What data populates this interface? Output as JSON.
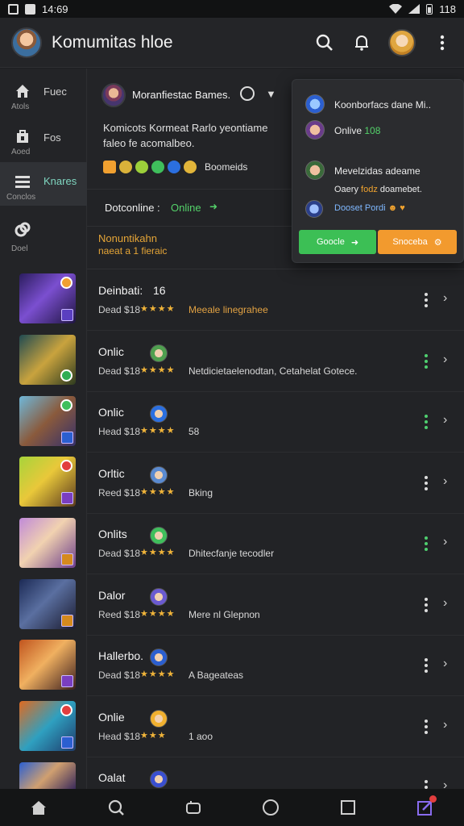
{
  "status_bar": {
    "time": "14:69",
    "battery": "118"
  },
  "app_bar": {
    "title": "Komumitas hloe"
  },
  "sidebar": {
    "items": [
      {
        "label": "Fuec",
        "sub": "Atols",
        "icon": "home-icon"
      },
      {
        "label": "Fos",
        "sub": "Aoed",
        "icon": "store-icon"
      },
      {
        "label": "Knares",
        "sub": "Conclos",
        "icon": "list-icon"
      },
      {
        "label": "",
        "sub": "Doel",
        "icon": "link-icon"
      }
    ]
  },
  "header_card": {
    "name": "Moranfiestac Bames.",
    "description": "Komicots Kormeat Rarlo yeontiame faleo fe acomalbeo.",
    "badge_label": "Boomeids"
  },
  "online_row": {
    "label": "Dotconline :",
    "value": "Online"
  },
  "notice": {
    "line1": "Nonuntikahn",
    "line2": "naeat a 1 fieraic"
  },
  "games": [
    {
      "title": "Deinbati:",
      "count": "16",
      "sub": "Dead $18",
      "stars": "★★★★",
      "tag": "Meeale linegrahee",
      "tag_style": "orange",
      "dots": "white"
    },
    {
      "title": "Onlic",
      "sub": "Dead $18",
      "stars": "★★★★",
      "tag": "Netdicietaelenodtan, Cetahelat Gotece.",
      "tag_style": "white",
      "dots": "green"
    },
    {
      "title": "Onlic",
      "sub": "Head $18",
      "stars": "★★★★",
      "tag": "58",
      "tag_style": "white",
      "dots": "green"
    },
    {
      "title": "Orltic",
      "sub": "Reed $18",
      "stars": "★★★★",
      "tag": "Bking",
      "tag_style": "white",
      "dots": "white"
    },
    {
      "title": "Onlits",
      "sub": "Dead $18",
      "stars": "★★★★",
      "tag": "Dhitecfanje tecodler",
      "tag_style": "white",
      "dots": "green"
    },
    {
      "title": "Dalor",
      "sub": "Reed $18",
      "stars": "★★★★",
      "tag": "Mere nl Glepnon",
      "tag_style": "white",
      "dots": "white"
    },
    {
      "title": "Hallerbo.",
      "sub": "Dead $18",
      "stars": "★★★★",
      "tag": "A Bageateas",
      "tag_style": "white",
      "dots": "white"
    },
    {
      "title": "Onlie",
      "sub": "Head $18",
      "stars": "★★★",
      "tag": "1 aoo",
      "tag_style": "white",
      "dots": "white"
    },
    {
      "title": "Oalat",
      "sub": "",
      "stars": "",
      "tag": "",
      "tag_style": "white",
      "dots": "white"
    }
  ],
  "popover": {
    "row1": "Koonborfacs dane Mi..",
    "row2_text": "Onlive",
    "row2_highlight": "108",
    "row3": "Mevelzidas adeame",
    "row4_pre": "Oaery",
    "row4_orange": "fodz",
    "row4_post": "doamebet.",
    "row5": "Dooset Pordi",
    "btn_green": "Goocle",
    "btn_orange": "Snoceba"
  },
  "colors": {
    "accent_green": "#54d26a",
    "accent_orange": "#f29a2e",
    "background": "#222326"
  }
}
